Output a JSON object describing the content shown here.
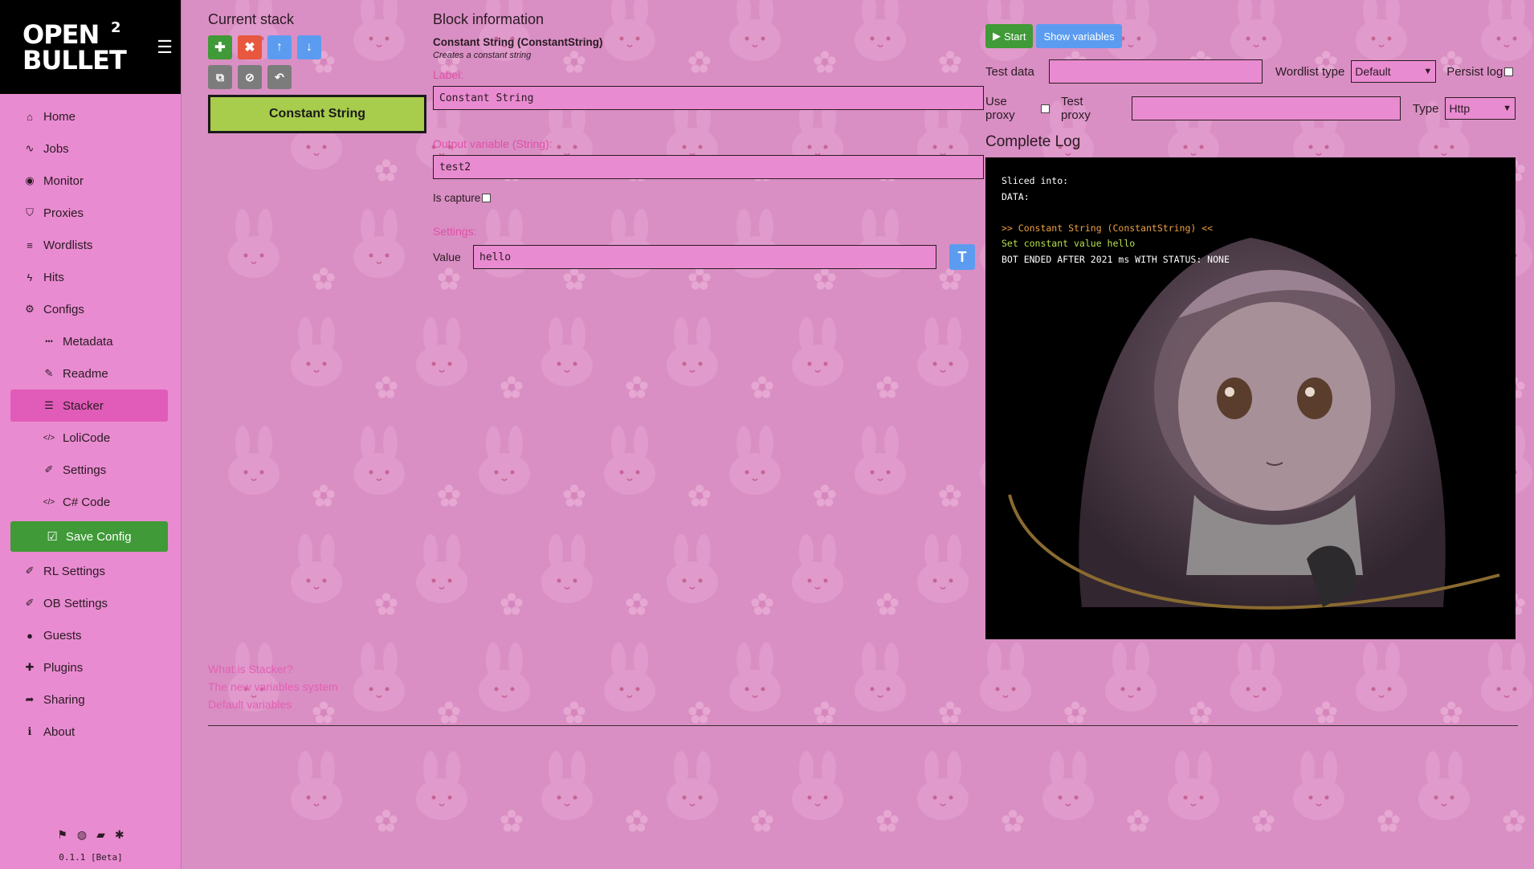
{
  "sidebar": {
    "brand": {
      "line1": "OPEN",
      "line2": "BULLET",
      "version_mark": "2"
    },
    "hamburger": "☰",
    "items": [
      {
        "label": "Home",
        "icon": "home-icon",
        "glyph": "⌂"
      },
      {
        "label": "Jobs",
        "icon": "pulse-icon",
        "glyph": "∿"
      },
      {
        "label": "Monitor",
        "icon": "eye-icon",
        "glyph": "◉"
      },
      {
        "label": "Proxies",
        "icon": "shield-icon",
        "glyph": "⛉"
      },
      {
        "label": "Wordlists",
        "icon": "list-icon",
        "glyph": "≡"
      },
      {
        "label": "Hits",
        "icon": "bolt-icon",
        "glyph": "ϟ"
      },
      {
        "label": "Configs",
        "icon": "gear-icon",
        "glyph": "⚙"
      }
    ],
    "sub_items": [
      {
        "label": "Metadata",
        "icon": "ellipsis-icon",
        "glyph": "•••"
      },
      {
        "label": "Readme",
        "icon": "pencil-icon",
        "glyph": "✎"
      },
      {
        "label": "Stacker",
        "icon": "bars-icon",
        "glyph": "☰"
      },
      {
        "label": "LoliCode",
        "icon": "code-icon",
        "glyph": "</>"
      },
      {
        "label": "Settings",
        "icon": "wrench-icon",
        "glyph": "✐"
      },
      {
        "label": "C# Code",
        "icon": "code-icon",
        "glyph": "</>"
      }
    ],
    "save_label": "Save Config",
    "bottom_items": [
      {
        "label": "RL Settings",
        "icon": "wrench-icon",
        "glyph": "✐"
      },
      {
        "label": "OB Settings",
        "icon": "wrench-icon",
        "glyph": "✐"
      },
      {
        "label": "Guests",
        "icon": "user-icon",
        "glyph": "●"
      },
      {
        "label": "Plugins",
        "icon": "puzzle-icon",
        "glyph": "✚"
      },
      {
        "label": "Sharing",
        "icon": "share-icon",
        "glyph": "➦"
      },
      {
        "label": "About",
        "icon": "info-icon",
        "glyph": "ℹ"
      }
    ],
    "footer_icons": [
      "flag-icon",
      "globe-icon",
      "book-icon",
      "bug-icon"
    ],
    "version": "0.1.1 [Beta]"
  },
  "stack": {
    "title": "Current stack",
    "block_label": "Constant String"
  },
  "help": {
    "links": [
      "What is Stacker?",
      "The new variables system",
      "Default variables"
    ]
  },
  "block_info": {
    "title": "Block information",
    "name": "Constant String (ConstantString)",
    "description": "Creates a constant string",
    "label_title": "Label:",
    "label_value": "Constant String",
    "output_title": "Output variable (String):",
    "output_value": "test2",
    "capture_label": "Is capture",
    "settings_title": "Settings:",
    "value_label": "Value",
    "value": "hello",
    "type_switch": "T"
  },
  "debugger": {
    "start_label": "Start",
    "show_vars_label": "Show variables",
    "test_data_label": "Test data",
    "wordlist_type_label": "Wordlist type",
    "wordlist_type_value": "Default",
    "persist_log_label": "Persist log",
    "use_proxy_label": "Use proxy",
    "test_proxy_label": "Test proxy",
    "type_label": "Type",
    "type_value": "Http"
  },
  "log": {
    "title": "Complete Log",
    "lines": [
      {
        "text": "Sliced into:",
        "color": "#ffffff"
      },
      {
        "text": "DATA:",
        "color": "#ffffff"
      },
      {
        "text": "",
        "color": "#ffffff"
      },
      {
        "text": ">> Constant String (ConstantString) <<",
        "color": "#f0a040"
      },
      {
        "text": "Set constant value hello",
        "color": "#b6e04a"
      },
      {
        "text": "BOT ENDED AFTER 2021 ms WITH STATUS: NONE",
        "color": "#ffffff"
      }
    ]
  },
  "colors": {
    "accent_pink": "#e04fa8",
    "sidebar": "#e98bd0",
    "green": "#3f9a37",
    "blue": "#5b9cf0",
    "block_green": "#a8cc4c"
  }
}
